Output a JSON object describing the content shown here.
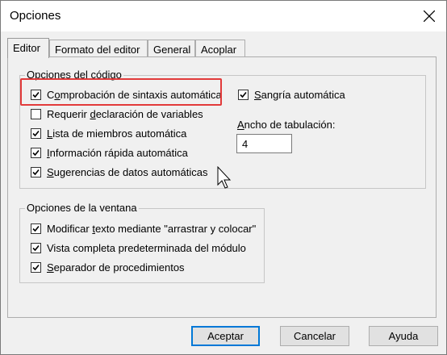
{
  "window": {
    "title": "Opciones"
  },
  "tabs": [
    {
      "label": "Editor",
      "active": true
    },
    {
      "label": "Formato del editor",
      "active": false
    },
    {
      "label": "General",
      "active": false
    },
    {
      "label": "Acoplar",
      "active": false
    }
  ],
  "code_options": {
    "title": "Opciones del código",
    "left_items": [
      {
        "pre": "C",
        "u": "o",
        "post": "mprobación de sintaxis automática",
        "checked": true
      },
      {
        "pre": "Requerir ",
        "u": "d",
        "post": "eclaración de variables",
        "checked": false
      },
      {
        "pre": "",
        "u": "L",
        "post": "ista de miembros automática",
        "checked": true
      },
      {
        "pre": "",
        "u": "I",
        "post": "nformación rápida automática",
        "checked": true
      },
      {
        "pre": "",
        "u": "S",
        "post": "ugerencias de datos automáticas",
        "checked": true
      }
    ],
    "auto_indent": {
      "pre": "",
      "u": "S",
      "post": "angría automática",
      "checked": true
    },
    "tab_width": {
      "pre": "",
      "u": "A",
      "post": "ncho de tabulación:",
      "value": "4"
    }
  },
  "window_options": {
    "title": "Opciones de la ventana",
    "items": [
      {
        "pre": "Modificar ",
        "u": "t",
        "post": "exto mediante \"arrastrar y colocar\"",
        "checked": true
      },
      {
        "pre": "Vista completa predeterminada del módulo",
        "u": "",
        "post": "",
        "checked": true
      },
      {
        "pre": "",
        "u": "S",
        "post": "eparador de procedimientos",
        "checked": true
      }
    ]
  },
  "buttons": {
    "accept": "Aceptar",
    "cancel": "Cancelar",
    "help": "Ayuda"
  }
}
